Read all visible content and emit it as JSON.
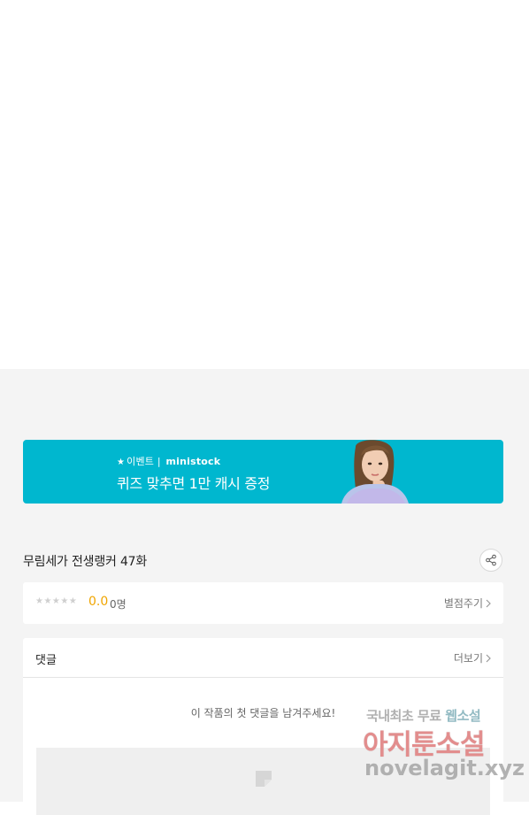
{
  "banner": {
    "event_star": "★",
    "event_label": "이벤트",
    "event_divider": "|",
    "event_brand": "ministock",
    "headline": "퀴즈 맞추면 1만 캐시 증정",
    "accent_color": "#00b7cf"
  },
  "episode": {
    "title": "무림세가 전생랭커 47화",
    "share_icon": "share-icon"
  },
  "rating": {
    "stars": "★★★★★",
    "score": "0.0",
    "count": "0명",
    "rate_button_label": "별점주기",
    "score_color": "#f0a500"
  },
  "comments": {
    "section_label": "댓글",
    "more_label": "더보기",
    "empty_message": "이 작품의 첫 댓글을 남겨주세요!"
  },
  "watermark": {
    "line1_prefix": "국내최초 무료",
    "line1_accent": "웹소설",
    "line2": "아지툰소설",
    "line3": "novelagit.xyz"
  }
}
